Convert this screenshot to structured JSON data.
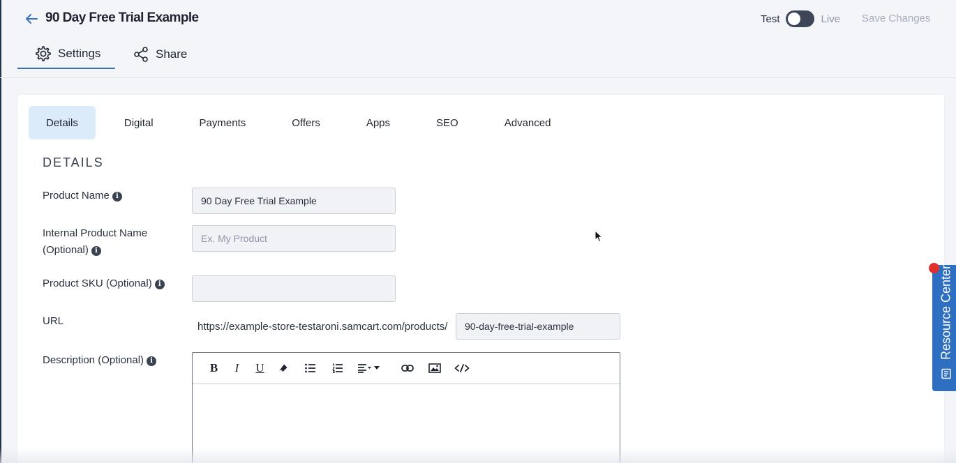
{
  "header": {
    "title": "90 Day Free Trial Example",
    "mode": {
      "test_label": "Test",
      "live_label": "Live"
    },
    "save_label": "Save Changes"
  },
  "top_tabs": [
    {
      "label": "Settings",
      "icon": "gear-icon",
      "active": true
    },
    {
      "label": "Share",
      "icon": "share-icon",
      "active": false
    }
  ],
  "section_tabs": [
    {
      "label": "Details",
      "active": true
    },
    {
      "label": "Digital"
    },
    {
      "label": "Payments"
    },
    {
      "label": "Offers"
    },
    {
      "label": "Apps"
    },
    {
      "label": "SEO"
    },
    {
      "label": "Advanced"
    }
  ],
  "details": {
    "heading": "DETAILS",
    "product_name": {
      "label": "Product Name",
      "value": "90 Day Free Trial Example"
    },
    "internal_name": {
      "label_line1": "Internal Product Name",
      "label_line2": "(Optional)",
      "placeholder": "Ex. My Product"
    },
    "sku": {
      "label": "Product SKU (Optional)",
      "value": ""
    },
    "url": {
      "label": "URL",
      "prefix": "https://example-store-testaroni.samcart.com/products/",
      "slug": "90-day-free-trial-example"
    },
    "description": {
      "label": "Description (Optional)"
    }
  },
  "editor_toolbar": [
    "bold",
    "italic",
    "underline",
    "eraser",
    "bulleted-list",
    "numbered-list",
    "align",
    "more",
    "link",
    "image",
    "code"
  ],
  "resource_center": {
    "label": "Resource Center"
  },
  "colors": {
    "accent": "#2e6fc1",
    "active_tab_bg": "#dcebf9",
    "notification": "#e0302c"
  }
}
